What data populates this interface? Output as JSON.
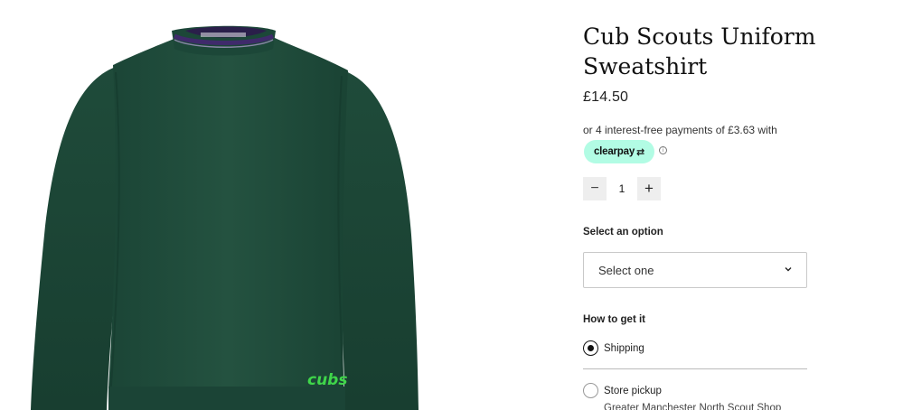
{
  "product": {
    "title_line1": "Cub Scouts Uniform",
    "title_line2": "Sweatshirt",
    "price": "£14.50",
    "installment_text": "or 4 interest-free payments of £3.63 with",
    "clearpay_label": "clearpay",
    "clearpay_icon": "clearpay-arrows-icon",
    "info_icon": "ⓘ",
    "image_text": "cubs",
    "colors": {
      "sweatshirt": "#1f4b3a",
      "collar": "#3f2a6b",
      "clearpay": "#b2fce4",
      "cubs_logo": "#3fd64a"
    }
  },
  "quantity": {
    "minus": "−",
    "value": "1",
    "plus": "+"
  },
  "option": {
    "label": "Select an option",
    "placeholder": "Select one"
  },
  "fulfilment": {
    "label": "How to get it",
    "options": [
      {
        "label": "Shipping",
        "selected": true
      },
      {
        "label": "Store pickup",
        "selected": false
      }
    ],
    "store_name": "Greater Manchester North Scout Shop"
  }
}
